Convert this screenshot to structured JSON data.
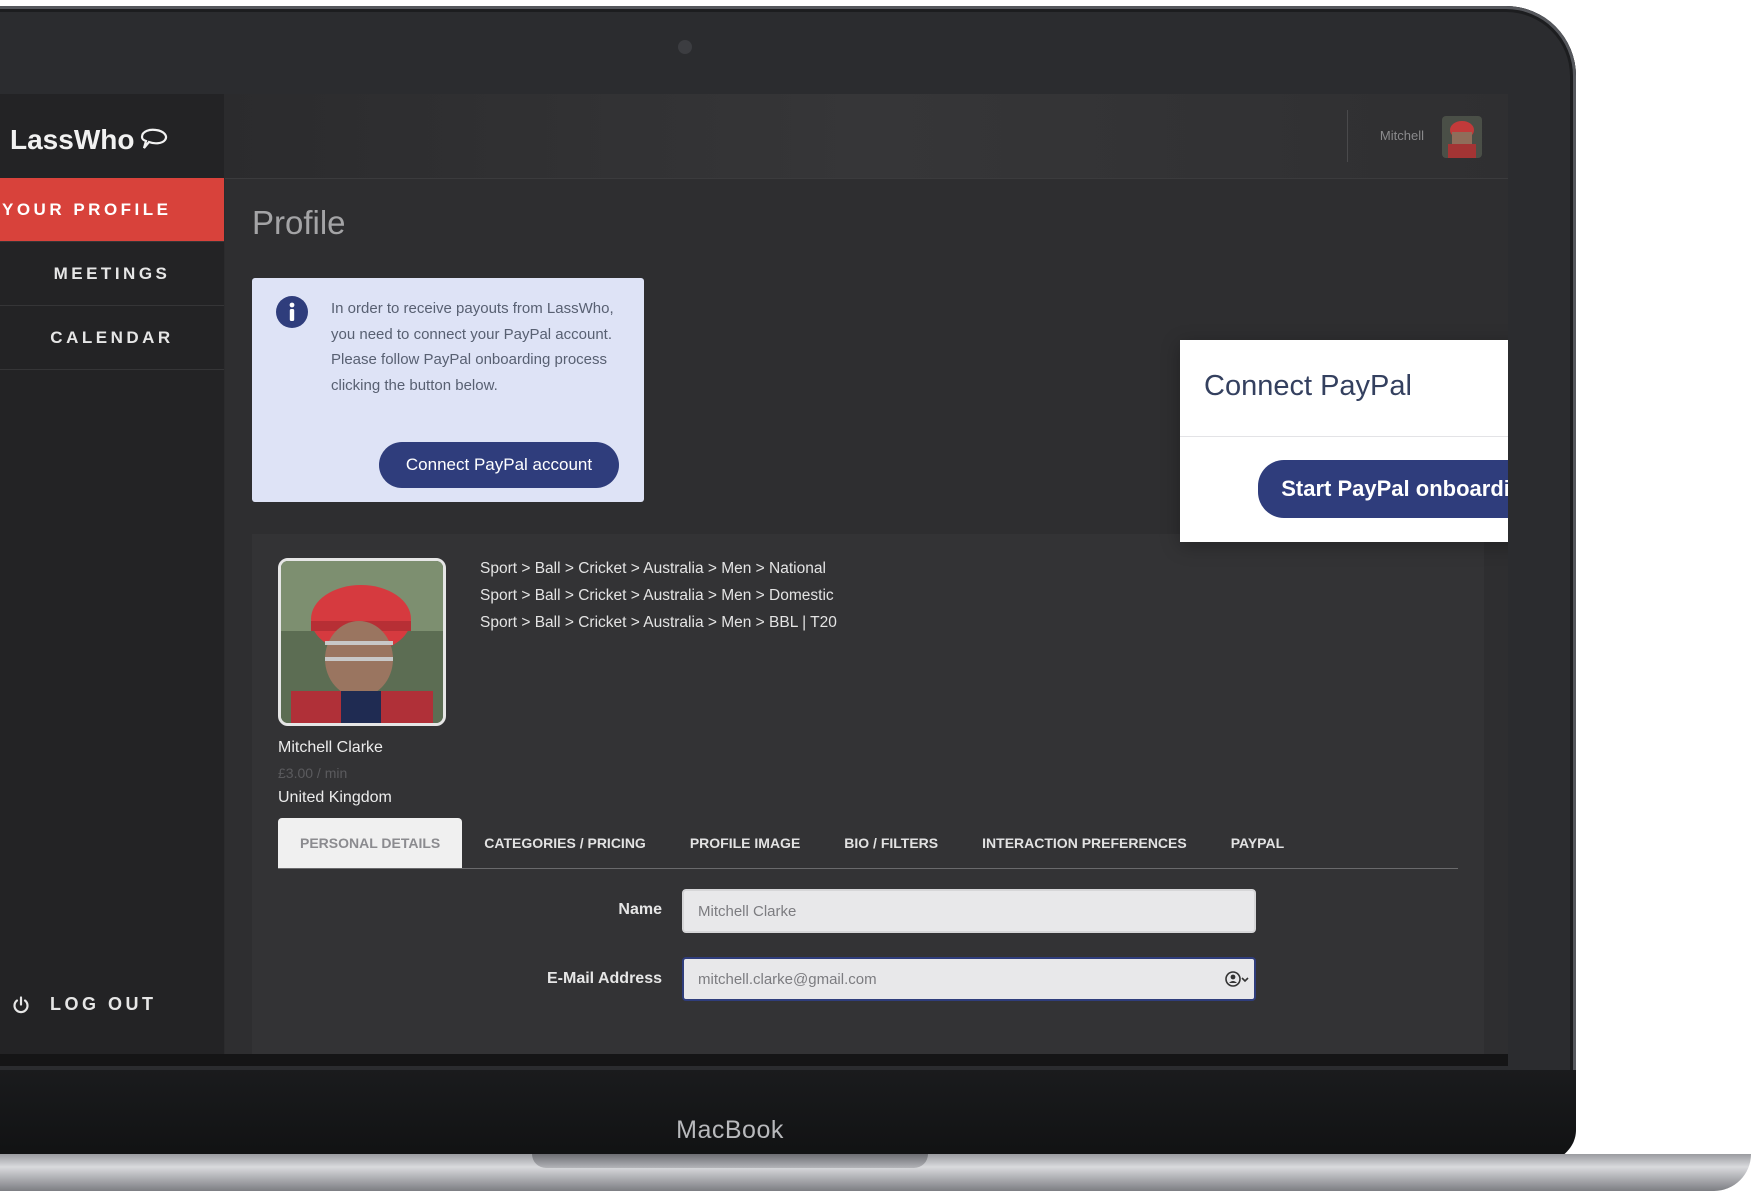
{
  "device": {
    "label": "MacBook"
  },
  "app": {
    "logo_text": "LassWho"
  },
  "topbar": {
    "user_name": "Mitchell"
  },
  "sidebar": {
    "items": [
      {
        "label": "YOUR PROFILE",
        "active": true
      },
      {
        "label": "MEETINGS",
        "active": false
      },
      {
        "label": "CALENDAR",
        "active": false
      }
    ],
    "logout_label": "LOG OUT"
  },
  "page": {
    "title": "Profile"
  },
  "info_box": {
    "text": "In order to receive payouts from LassWho, you need to connect your PayPal account. Please follow PayPal onboarding process clicking the button below.",
    "button_label": "Connect PayPal account"
  },
  "profile": {
    "name": "Mitchell Clarke",
    "rate": "£3.00 / min",
    "country": "United Kingdom",
    "categories": [
      "Sport > Ball > Cricket > Australia > Men > National",
      "Sport > Ball > Cricket > Australia > Men > Domestic",
      "Sport > Ball > Cricket > Australia > Men > BBL | T20"
    ]
  },
  "tabs": [
    {
      "label": "PERSONAL DETAILS",
      "active": true
    },
    {
      "label": "CATEGORIES / PRICING",
      "active": false
    },
    {
      "label": "PROFILE IMAGE",
      "active": false
    },
    {
      "label": "BIO / FILTERS",
      "active": false
    },
    {
      "label": "INTERACTION PREFERENCES",
      "active": false
    },
    {
      "label": "PAYPAL",
      "active": false
    }
  ],
  "form": {
    "name_label": "Name",
    "name_value": "Mitchell Clarke",
    "email_label": "E-Mail Address",
    "email_value": "mitchell.clarke@gmail.com"
  },
  "modal": {
    "title": "Connect PayPal",
    "button_label": "Start PayPal onboarding"
  },
  "colors": {
    "accent_red": "#d8423b",
    "button_navy": "#2f3d7c",
    "info_bg": "#dee3f6",
    "app_bg": "#2e2e30"
  },
  "icons": [
    "logo-bubble-icon",
    "power-icon",
    "info-icon",
    "autofill-person-icon",
    "close-icon"
  ]
}
